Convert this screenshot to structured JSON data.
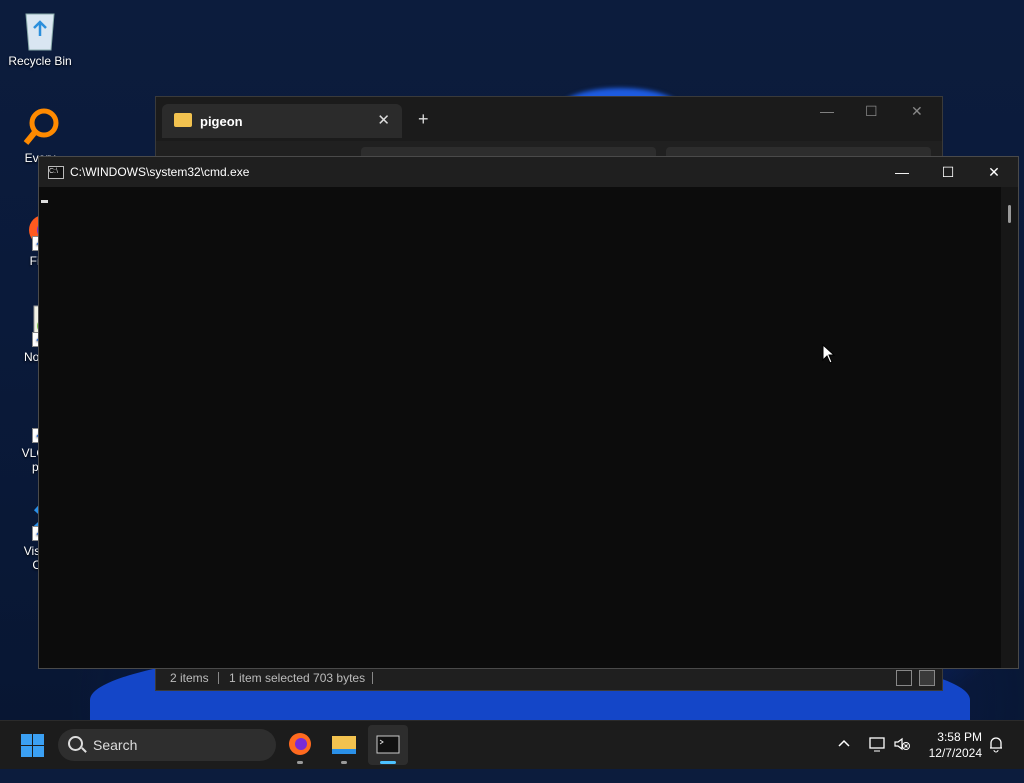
{
  "desktop": {
    "icons": [
      {
        "label": "Recycle Bin"
      },
      {
        "label": "Every"
      },
      {
        "label": "Fire"
      },
      {
        "label": "Notep"
      },
      {
        "label_line1": "VLC m",
        "label_line2": "pla"
      },
      {
        "label_line1": "Visual",
        "label_line2": "Co"
      }
    ]
  },
  "explorer": {
    "tab_title": "pigeon",
    "close_tab_glyph": "✕",
    "new_tab_glyph": "+",
    "status": {
      "items": "2 items",
      "selected": "1 item selected  703 bytes"
    }
  },
  "cmd": {
    "title": "C:\\WINDOWS\\system32\\cmd.exe",
    "minimize_glyph": "—",
    "maximize_glyph": "☐",
    "close_glyph": "✕"
  },
  "taskbar": {
    "search_label": "Search",
    "apps": [
      "Firefox",
      "File Explorer",
      "Command Prompt"
    ],
    "active_app": "Command Prompt"
  },
  "tray": {
    "time": "3:58 PM",
    "date": "12/7/2024"
  },
  "colors": {
    "accent": "#4cc2ff",
    "start": "#3ba0f3",
    "folder": "#f2c24f"
  }
}
